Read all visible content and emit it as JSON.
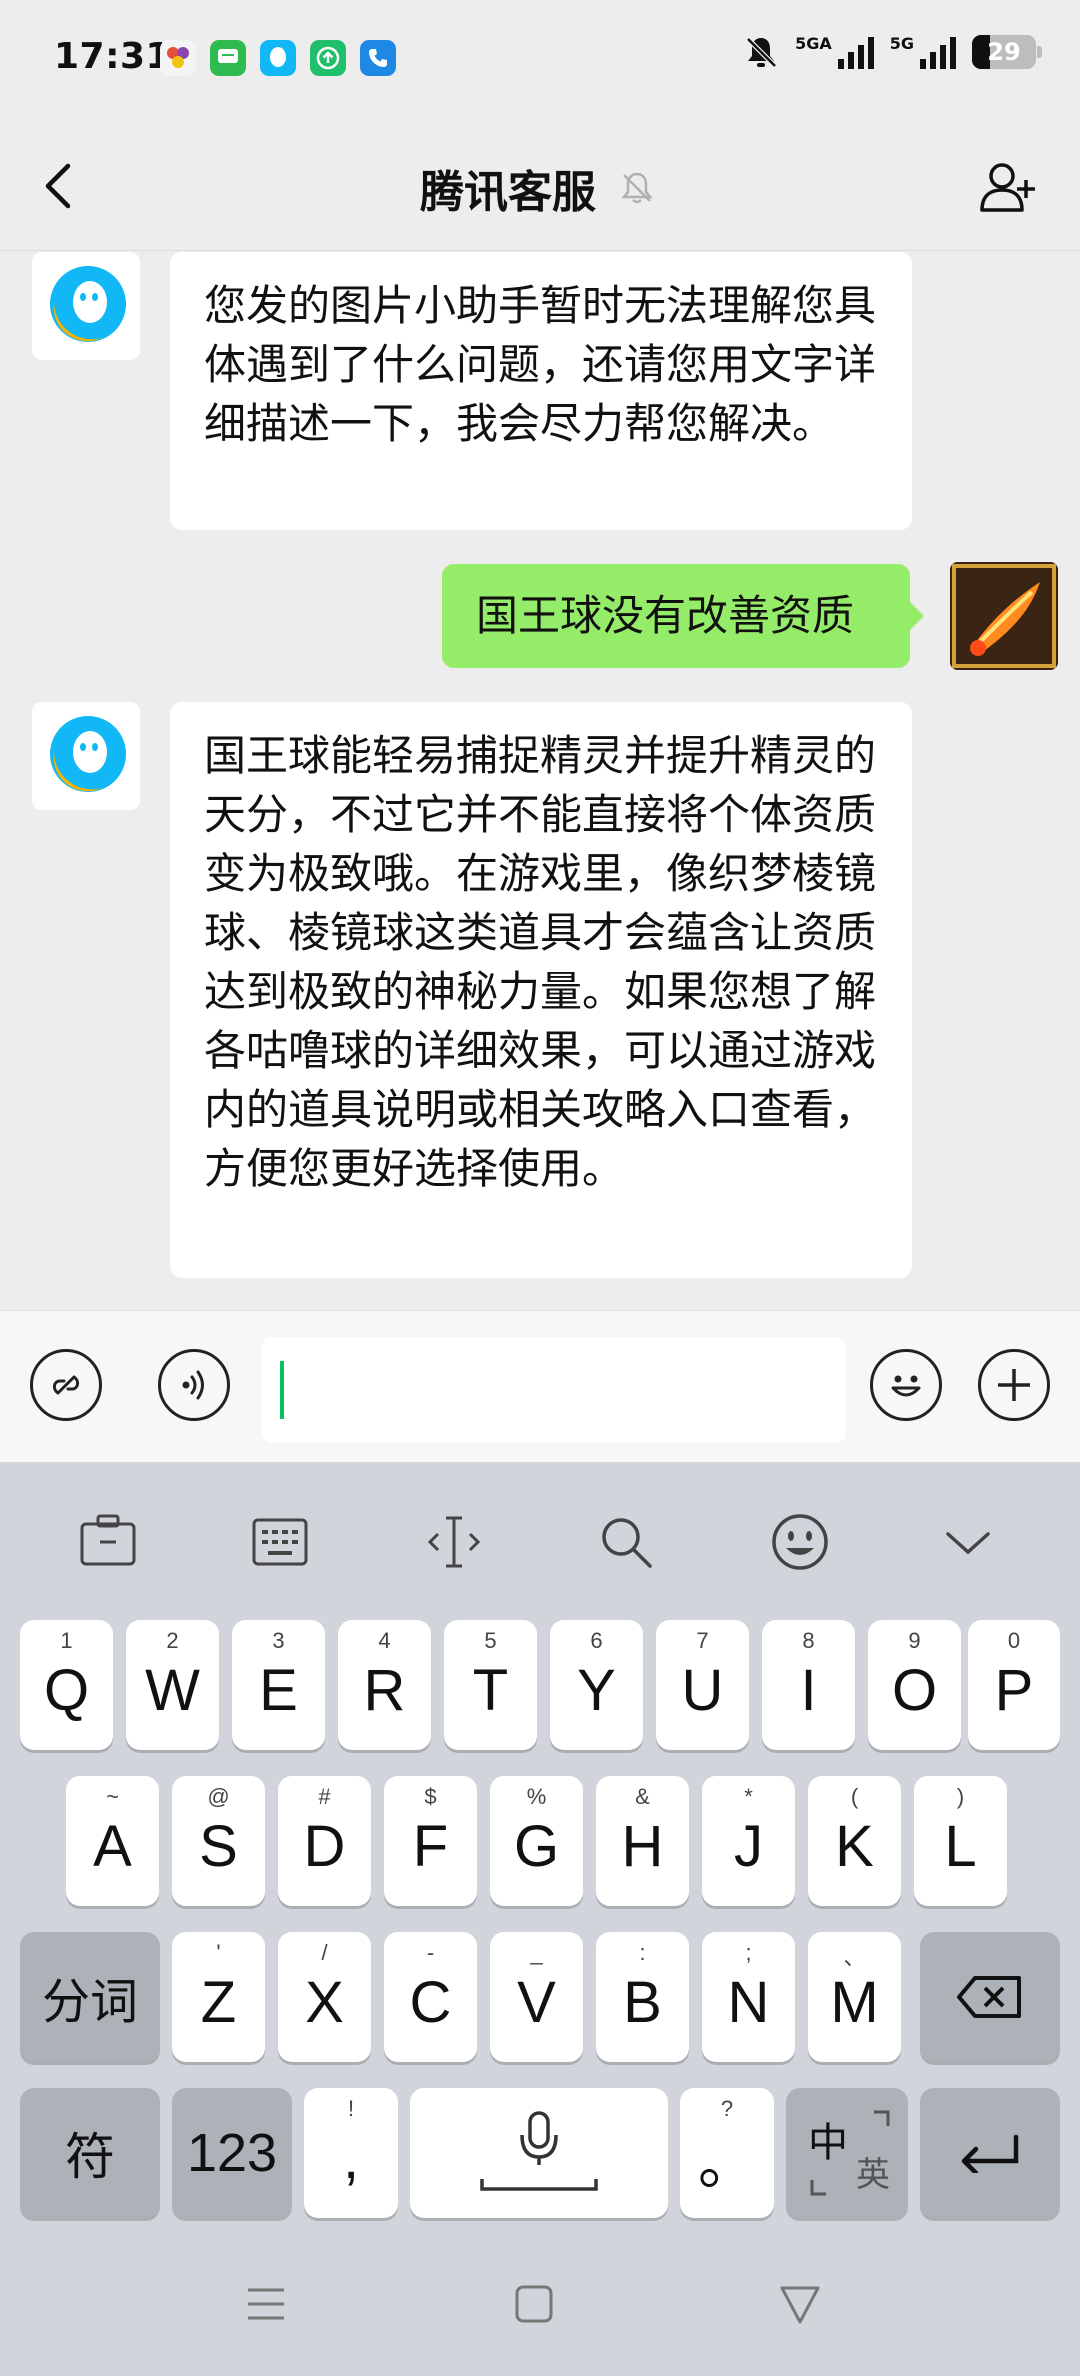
{
  "status_bar": {
    "time": "17:31",
    "net1": "5GA",
    "net2": "5G",
    "battery": "29"
  },
  "header": {
    "title": "腾讯客服"
  },
  "messages": [
    {
      "from": "bot",
      "text": "您发的图片小助手暂时无法理解您具体遇到了什么问题，还请您用文字详细描述一下，我会尽力帮您解决。"
    },
    {
      "from": "user",
      "text": "国王球没有改善资质"
    },
    {
      "from": "bot",
      "text": "国王球能轻易捕捉精灵并提升精灵的天分，不过它并不能直接将个体资质变为极致哦。在游戏里，像织梦棱镜球、棱镜球这类道具才会蕴含让资质达到极致的神秘力量。如果您想了解各咕噜球的详细效果，可以通过游戏内的道具说明或相关攻略入口查看，方便您更好选择使用。"
    }
  ],
  "input": {
    "value": "",
    "placeholder": ""
  },
  "keyboard": {
    "row1": [
      {
        "key": "Q",
        "hint": "1"
      },
      {
        "key": "W",
        "hint": "2"
      },
      {
        "key": "E",
        "hint": "3"
      },
      {
        "key": "R",
        "hint": "4"
      },
      {
        "key": "T",
        "hint": "5"
      },
      {
        "key": "Y",
        "hint": "6"
      },
      {
        "key": "U",
        "hint": "7"
      },
      {
        "key": "I",
        "hint": "8"
      },
      {
        "key": "O",
        "hint": "9"
      },
      {
        "key": "P",
        "hint": "0"
      }
    ],
    "row2": [
      {
        "key": "A",
        "hint": "~"
      },
      {
        "key": "S",
        "hint": "@"
      },
      {
        "key": "D",
        "hint": "#"
      },
      {
        "key": "F",
        "hint": "$"
      },
      {
        "key": "G",
        "hint": "%"
      },
      {
        "key": "H",
        "hint": "&"
      },
      {
        "key": "J",
        "hint": "*"
      },
      {
        "key": "K",
        "hint": "("
      },
      {
        "key": "L",
        "hint": ")"
      }
    ],
    "row3": [
      {
        "key": "Z",
        "hint": "'"
      },
      {
        "key": "X",
        "hint": "/"
      },
      {
        "key": "C",
        "hint": "-"
      },
      {
        "key": "V",
        "hint": "_"
      },
      {
        "key": "B",
        "hint": ":"
      },
      {
        "key": "N",
        "hint": ";"
      },
      {
        "key": "M",
        "hint": "、"
      }
    ],
    "segment_label": "分词",
    "symbol_label": "符",
    "numbers_label": "123",
    "comma_key": ",",
    "comma_hint": "!",
    "period_key": "。",
    "period_hint": "?",
    "lang_primary": "中",
    "lang_secondary": "英"
  },
  "colors": {
    "accent_green": "#07c160",
    "my_bubble": "#95ec69",
    "qq_blue": "#12b7f5"
  }
}
